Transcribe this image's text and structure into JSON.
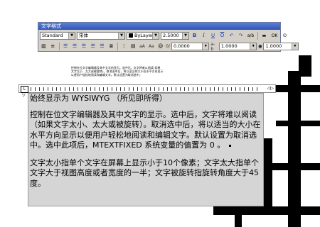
{
  "toolbar": {
    "title": "文字格式",
    "style_value": "Standard",
    "font_value": "宋体",
    "color_value": "ByLayer",
    "height_value": "2.5000",
    "bold": "B",
    "italic": "I",
    "underline": "U",
    "overline": "O",
    "undo_icon": "↶",
    "redo_icon": "↷",
    "stack_label": "a/b",
    "ok_label": "OK",
    "angle_value": "0.0000",
    "tracking_label": "a-b",
    "tracking_value": "1.0000",
    "width_value": "1.0000",
    "uppercase_label": "aA",
    "lowercase_label": "Aa",
    "symbol_label": "@",
    "oblique_label": "0/"
  },
  "preview": {
    "line1": "控制在位文字编辑器及其中文字的显示。选中后，文字将难以阅读(如果",
    "line2": "文字太小、太大或被旋转)。取消选中后，将以适当的大小在水平方向显示",
    "line3": "以便用户轻松地阅读和编辑文字。默认设置为取消选中。"
  },
  "editor": {
    "heading": "始终显示为 WYSIWYG （所见即所得）",
    "paragraph1": "控制在位文字编辑器及其中文字的显示。选中后，文字将难以阅读（如果文字太小、太大或被旋转）。取消选中后，将以适当的大小在水平方向显示以便用户轻松地阅读和编辑文字。默认设置为取消选中。选中此项后，MTEXTFIXED 系统变量的值置为 0 。",
    "paragraph2": "文字太小指单个文字在屏幕上显示小于10个像素；文字太大指单个文字大于视图高度或者宽度的一半；文字被旋转指旋转角度大于45度。"
  },
  "ruler": {
    "indent_marker": "L",
    "end_marker": "◁▷"
  },
  "icons": {
    "ok": "ok-button-icon",
    "ruler": "ruler-icon",
    "color": "color-swatch-icon"
  }
}
